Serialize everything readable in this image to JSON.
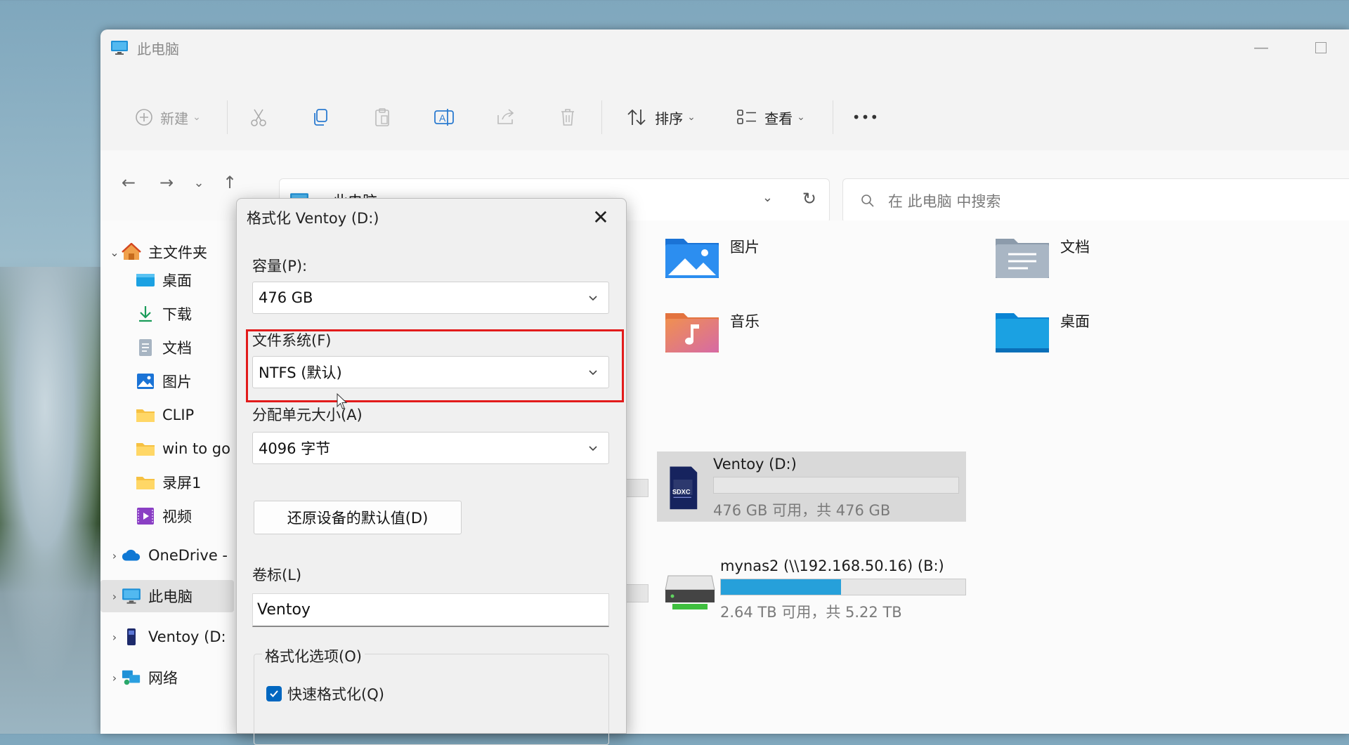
{
  "window": {
    "title": "此电脑"
  },
  "toolbar": {
    "new_label": "新建",
    "sort_label": "排序",
    "view_label": "查看",
    "more_label": "•••"
  },
  "address": {
    "location": "此电脑",
    "separator": "›"
  },
  "search": {
    "placeholder": "在 此电脑 中搜索"
  },
  "sidebar": {
    "items": [
      {
        "label": "主文件夹",
        "icon": "home-icon"
      },
      {
        "label": "桌面",
        "icon": "desktop-folder-icon"
      },
      {
        "label": "下载",
        "icon": "download-icon"
      },
      {
        "label": "文档",
        "icon": "document-icon"
      },
      {
        "label": "图片",
        "icon": "pictures-icon"
      },
      {
        "label": "CLIP",
        "icon": "folder-icon"
      },
      {
        "label": "win to go",
        "icon": "folder-icon"
      },
      {
        "label": "录屏1",
        "icon": "folder-icon"
      },
      {
        "label": "视频",
        "icon": "video-icon"
      },
      {
        "label": "OneDrive -",
        "icon": "cloud-icon"
      },
      {
        "label": "此电脑",
        "icon": "computer-icon"
      },
      {
        "label": "Ventoy (D:",
        "icon": "usb-drive-icon"
      },
      {
        "label": "网络",
        "icon": "network-icon"
      }
    ]
  },
  "folders": [
    {
      "label": "图片",
      "icon": "pictures-folder-icon"
    },
    {
      "label": "文档",
      "icon": "documents-folder-icon"
    },
    {
      "label": "音乐",
      "icon": "music-folder-icon"
    },
    {
      "label": "桌面",
      "icon": "desktop-folder-icon"
    }
  ],
  "drives": [
    {
      "name": "Ventoy (D:)",
      "free_text": "476 GB 可用，共 476 GB",
      "used_fraction": 0.0,
      "icon": "sdxc-card-icon"
    },
    {
      "name": "mynas2 (\\\\192.168.50.16) (B:)",
      "free_text": "2.64 TB 可用，共 5.22 TB",
      "used_fraction": 0.49,
      "icon": "network-drive-icon"
    }
  ],
  "dialog": {
    "title": "格式化 Ventoy (D:)",
    "capacity_label": "容量(P):",
    "capacity_value": "476 GB",
    "filesystem_label": "文件系统(F)",
    "filesystem_value": "NTFS (默认)",
    "allocation_label": "分配单元大小(A)",
    "allocation_value": "4096 字节",
    "restore_button": "还原设备的默认值(D)",
    "volume_label": "卷标(L)",
    "volume_value": "Ventoy",
    "options_label": "格式化选项(O)",
    "quick_format_label": "快速格式化(Q)",
    "quick_format_checked": true
  },
  "colors": {
    "accent": "#0067c0",
    "highlight": "#e21b1b",
    "drive_fill": "#26a0da"
  }
}
